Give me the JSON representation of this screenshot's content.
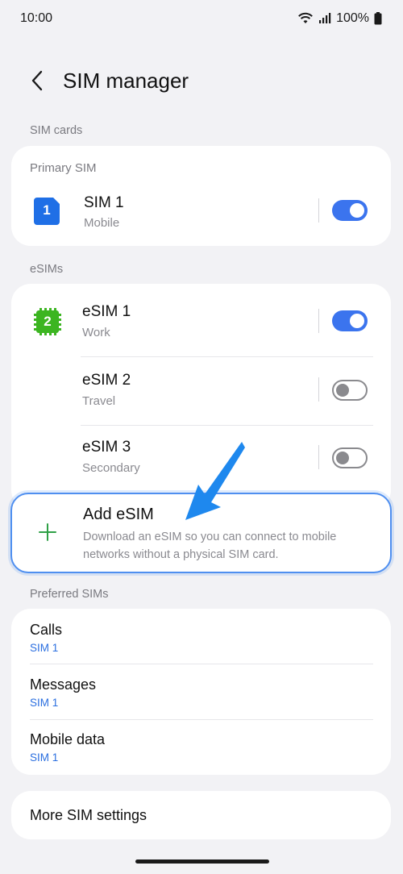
{
  "status": {
    "time": "10:00",
    "battery": "100%"
  },
  "header": {
    "title": "SIM manager"
  },
  "sim_cards": {
    "label": "SIM cards",
    "primary_label": "Primary SIM",
    "sim1": {
      "badge": "1",
      "name": "SIM 1",
      "type": "Mobile",
      "enabled": true
    }
  },
  "esims": {
    "label": "eSIMs",
    "items": [
      {
        "badge": "2",
        "name": "eSIM 1",
        "type": "Work",
        "enabled": true
      },
      {
        "name": "eSIM 2",
        "type": "Travel",
        "enabled": false
      },
      {
        "name": "eSIM 3",
        "type": "Secondary",
        "enabled": false
      }
    ],
    "add": {
      "title": "Add eSIM",
      "desc": "Download an eSIM so you can connect to mobile networks without a physical SIM card."
    }
  },
  "preferred": {
    "label": "Preferred SIMs",
    "items": [
      {
        "title": "Calls",
        "value": "SIM 1"
      },
      {
        "title": "Messages",
        "value": "SIM 1"
      },
      {
        "title": "Mobile data",
        "value": "SIM 1"
      }
    ]
  },
  "more": {
    "title": "More SIM settings"
  },
  "colors": {
    "accent": "#3b74ee",
    "sim_blue": "#1f6fe6",
    "esim_green": "#3cb521",
    "plus_green": "#2fa046"
  }
}
